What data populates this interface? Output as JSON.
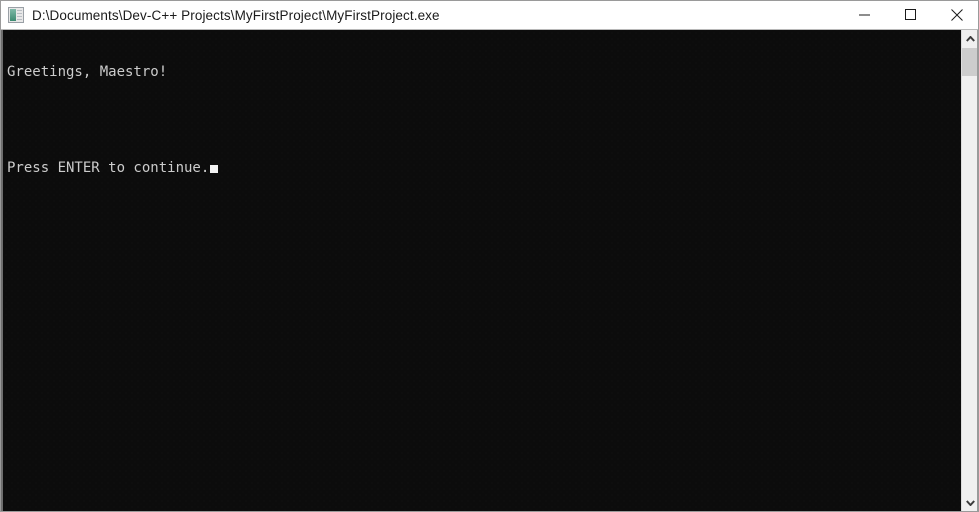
{
  "window": {
    "title": "D:\\Documents\\Dev-C++ Projects\\MyFirstProject\\MyFirstProject.exe",
    "icon": "console-app-icon",
    "controls": {
      "minimize_label": "Minimize",
      "minimize_icon": "minimize-icon",
      "maximize_label": "Maximize",
      "maximize_icon": "maximize-icon",
      "close_label": "Close",
      "close_icon": "close-icon"
    },
    "titlebar_background": "#ffffff",
    "titlebar_text_color": "#1b1b1b"
  },
  "console": {
    "background_color": "#0c0c0c",
    "text_color": "#cccccc",
    "cursor_color": "#f2f2f2",
    "lines": [
      "Greetings, Maestro!",
      "",
      "Press ENTER to continue."
    ],
    "line1": "Greetings, Maestro!",
    "line2": "",
    "line3": "Press ENTER to continue."
  },
  "scrollbar": {
    "up_arrow_icon": "chevron-up-icon",
    "down_arrow_icon": "chevron-down-icon",
    "thumb_name": "scrollbar-thumb",
    "track_color": "#f0f0f0",
    "thumb_color": "#cdcdcd"
  }
}
